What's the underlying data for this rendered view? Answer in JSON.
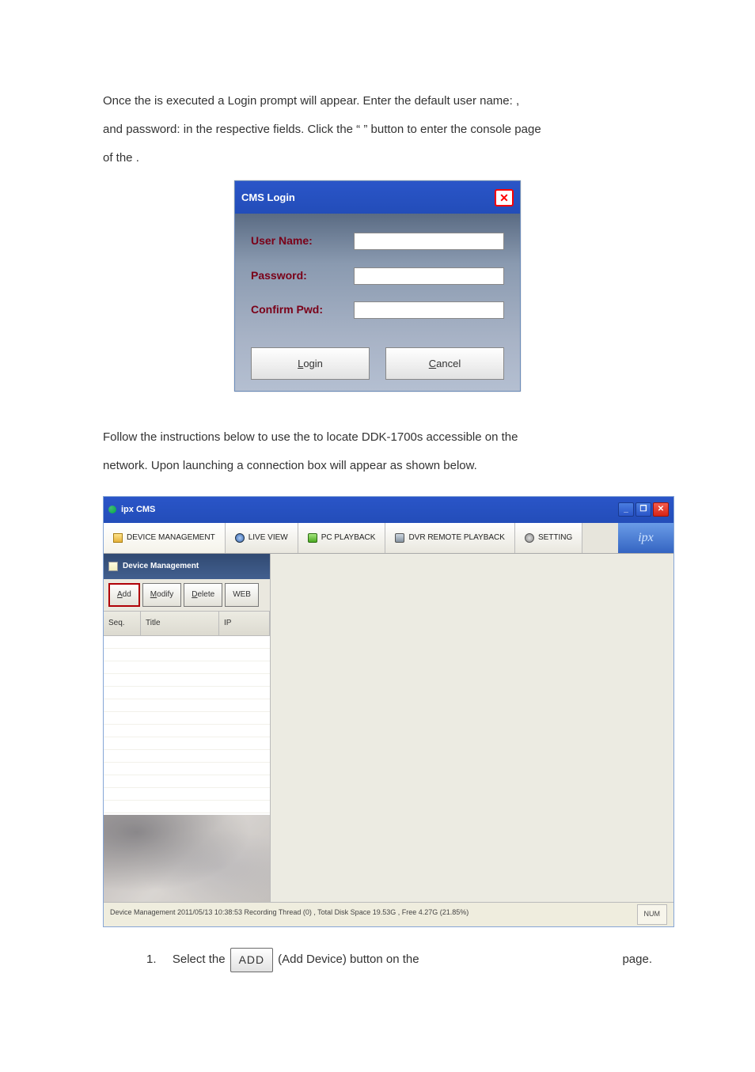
{
  "para1_a": "Once the ",
  "para1_b": " is executed a Login prompt will appear. Enter the default user name: ",
  "para1_c": ",",
  "para1_d": "and password: ",
  "para1_e": " in the respective fields. Click the “",
  "para1_f": "” button to enter the console page",
  "para1_g": "of the ",
  "para1_h": ".",
  "login": {
    "title": "CMS Login",
    "user_label": "User Name:",
    "pwd_label": "Password:",
    "confirm_label": "Confirm Pwd:",
    "login_btn": "Login",
    "cancel_btn": "Cancel"
  },
  "para2_a": "Follow the instructions below to use the ",
  "para2_b": " to locate DDK-1700s accessible on the",
  "para2_c": "network. Upon launching ",
  "para2_d": " a connection box will appear as shown below.",
  "cms": {
    "wintitle": "ipx CMS",
    "tabs": {
      "device": "DEVICE MANAGEMENT",
      "live": "LIVE VIEW",
      "pcpb": "PC PLAYBACK",
      "dvrpb": "DVR REMOTE PLAYBACK",
      "setting": "SETTING"
    },
    "logo": "ipx",
    "panel_title": "Device Management",
    "btn_add": "Add",
    "btn_modify": "Modify",
    "btn_delete": "Delete",
    "btn_web": "WEB",
    "col_seq": "Seq.",
    "col_title": "Title",
    "col_ip": "IP",
    "status": "Device Management  2011/05/13 10:38:53  Recording Thread (0) , Total Disk Space 19.53G , Free 4.27G (21.85%)",
    "num": "NUM"
  },
  "instr_num": "1.",
  "instr_a": "Select the",
  "instr_addbtn": "ADD",
  "instr_b": "(Add Device) button on the",
  "instr_c": "page."
}
